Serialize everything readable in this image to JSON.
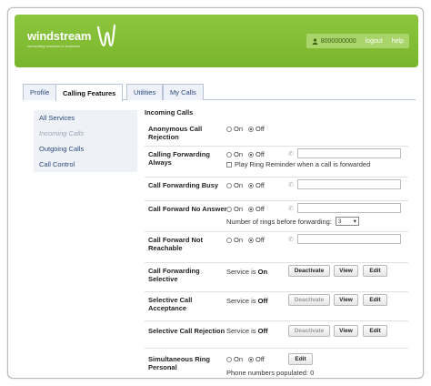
{
  "colors": {
    "brand_green": "#8cc63f",
    "link_blue": "#2d4a7c",
    "disabled_text": "#9aa6b8"
  },
  "header": {
    "logo_text": "windstream",
    "logo_tagline": "connecting business to business",
    "user_icon": "user-icon",
    "user_number": "8000000000",
    "logout_label": "logout",
    "help_label": "help"
  },
  "tabs": [
    {
      "label": "Profile",
      "active": false
    },
    {
      "label": "Calling Features",
      "active": true
    },
    {
      "label": "Utilities",
      "active": false
    },
    {
      "label": "My Calls",
      "active": false
    }
  ],
  "sidebar": {
    "items": [
      {
        "label": "All Services",
        "current": false
      },
      {
        "label": "Incoming Calls",
        "current": true
      },
      {
        "label": "Outgoing Calls",
        "current": false
      },
      {
        "label": "Call Control",
        "current": false
      }
    ]
  },
  "content": {
    "section_title": "Incoming Calls",
    "on_label": "On",
    "off_label": "Off",
    "service_is_label": "Service is",
    "rows": {
      "anonymous": {
        "label": "Anonymous Call Rejection",
        "selected": "Off"
      },
      "always": {
        "label": "Calling Forwarding Always",
        "selected": "Off",
        "checkbox_label": "Play Ring Reminder when a call is forwarded"
      },
      "busy": {
        "label": "Call Forwarding Busy",
        "selected": "Off"
      },
      "no_answer": {
        "label": "Call Forward No Answer",
        "selected": "Off",
        "rings_label": "Number of rings before forwarding:",
        "rings_value": "3"
      },
      "not_reachable": {
        "label": "Call Forward Not Reachable",
        "selected": "Off"
      },
      "selective": {
        "label": "Call Forwarding Selective",
        "status": "On",
        "deactivate": "Deactivate",
        "view": "View",
        "edit": "Edit"
      },
      "sel_accept": {
        "label": "Selective Call Acceptance",
        "status": "Off",
        "deactivate": "Deactivate",
        "view": "View",
        "edit": "Edit"
      },
      "sel_reject": {
        "label": "Selective Call Rejection",
        "status": "Off",
        "deactivate": "Deactivate",
        "view": "View",
        "edit": "Edit"
      },
      "simring": {
        "label": "Simultaneous Ring Personal",
        "selected": "Off",
        "edit": "Edit",
        "populated_text": "Phone numbers populated: 0"
      }
    }
  }
}
